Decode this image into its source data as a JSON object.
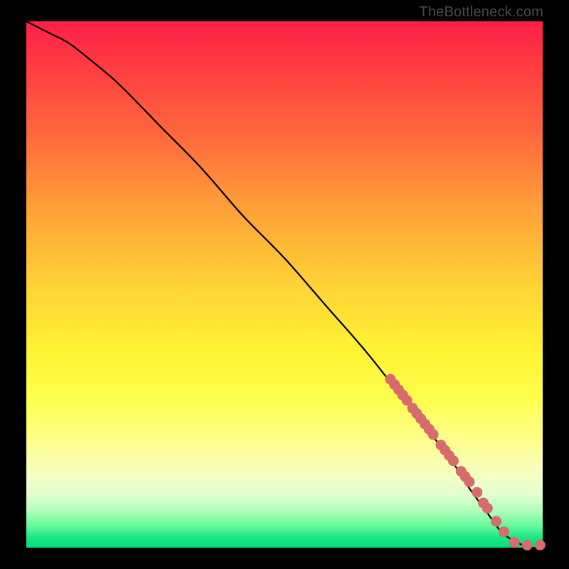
{
  "attribution": "TheBottleneck.com",
  "chart_data": {
    "type": "line",
    "title": "",
    "xlabel": "",
    "ylabel": "",
    "xlim": [
      0,
      100
    ],
    "ylim": [
      0,
      100
    ],
    "grid": false,
    "legend": false,
    "series": [
      {
        "name": "curve",
        "x": [
          0,
          4,
          8,
          12,
          18,
          26,
          34,
          42,
          50,
          58,
          66,
          74,
          82,
          86,
          89,
          92,
          95,
          98,
          100
        ],
        "y": [
          100,
          98,
          96,
          93,
          88,
          80,
          72,
          63,
          55,
          46,
          37,
          27,
          17,
          11,
          7,
          3,
          1,
          0,
          0
        ],
        "color": "#000000",
        "note": "thin main curve"
      },
      {
        "name": "highlight-dots",
        "x": [
          70.5,
          71.3,
          72.1,
          72.9,
          73.7,
          74.8,
          75.6,
          76.4,
          77.2,
          78.0,
          78.8,
          80.3,
          81.1,
          81.9,
          82.7,
          84.2,
          85.0,
          85.8,
          87.3,
          88.5,
          89.3,
          91.0,
          92.5,
          94.5,
          97.0,
          99.5
        ],
        "y": [
          32.0,
          31.0,
          30.0,
          29.0,
          28.0,
          26.5,
          25.5,
          24.5,
          23.5,
          22.5,
          21.5,
          19.5,
          18.5,
          17.5,
          16.5,
          14.5,
          13.5,
          12.5,
          10.5,
          8.5,
          7.5,
          5.0,
          3.0,
          1.0,
          0.5,
          0.5
        ],
        "color": "#d86b6b",
        "note": "thick salmon dotted overlay on lower-right segment"
      }
    ]
  }
}
